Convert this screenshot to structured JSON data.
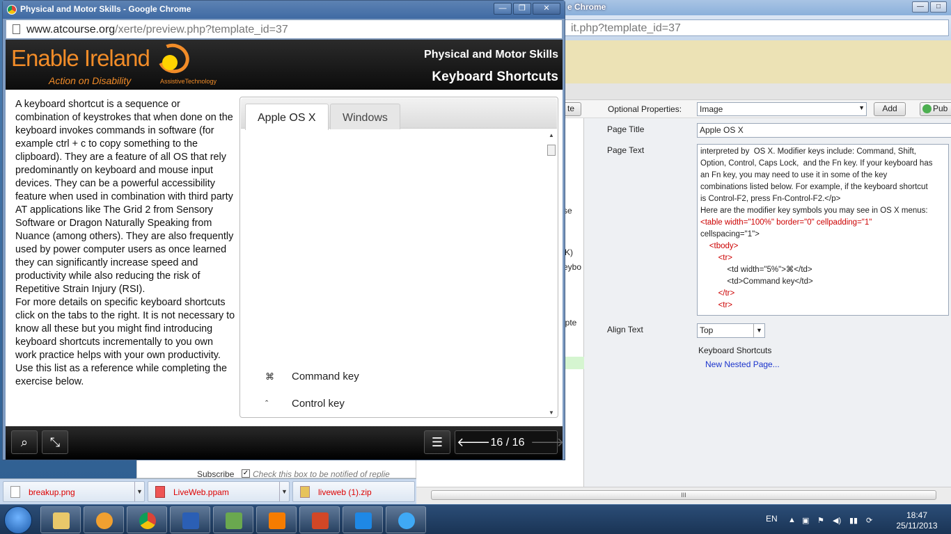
{
  "back_window": {
    "title_fragment": "e Chrome",
    "url_fragment": "it.php?template_id=37",
    "tab_fragment": "te",
    "optional_properties_label": "Optional Properties:",
    "optional_properties_value": "Image",
    "add_label": "Add",
    "pub_label": "Pub",
    "page_title_label": "Page Title",
    "page_title_value": "Apple OS X",
    "page_text_label": "Page Text",
    "align_text_label": "Align Text",
    "align_text_value": "Top",
    "keyboard_shortcuts_label": "Keyboard Shortcuts",
    "new_nested_page_label": "New Nested Page...",
    "side_fragments": [
      "se",
      "K)",
      "eybo",
      "apte"
    ],
    "code_lines": [
      "interpreted by  OS X. Modifier keys include: Command, Shift,",
      "Option, Control, Caps Lock,  and the Fn key. If your keyboard has",
      "an Fn key, you may need to use it in some of the key",
      "combinations listed below. For example, if the keyboard shortcut",
      "is Control-F2, press Fn-Control-F2.</p>",
      "Here are the modifier key symbols you may see in OS X menus:",
      "<table width=\"100%\" border=\"0\" cellpadding=\"1\"",
      "cellspacing=\"1\">",
      "    <tbody>",
      "        <tr>",
      "            <td width=\"5%\">⌘</td>",
      "            <td>Command key</td>",
      "        </tr>",
      "        <tr>"
    ]
  },
  "under_content": {
    "subscribe_label": "Subscribe",
    "checkbox_text": "Check this box to be notified of replie"
  },
  "downloads": [
    {
      "name": "breakup.png"
    },
    {
      "name": "LiveWeb.ppam"
    },
    {
      "name": "liveweb (1).zip"
    }
  ],
  "popup": {
    "title": "Physical and Motor Skills - Google Chrome",
    "url_domain": "www.atcourse.org",
    "url_path": "/xerte/preview.php?template_id=37",
    "logo_text": "Enable Ireland",
    "logo_tagline": "Action on Disability",
    "logo_sub": "AssistiveTechnology",
    "header_title": "Physical and Motor Skills",
    "header_subtitle": "Keyboard Shortcuts",
    "paragraph": "A keyboard shortcut is a sequence or combination of keystrokes that when done on the keyboard invokes commands in software (for example ctrl + c to copy something to the clipboard). They are a feature of all OS that rely predominantly on keyboard and mouse input devices. They can be a powerful accessibility feature when used in combination with third party AT applications like The Grid 2 from Sensory Software or Dragon Naturally Speaking from Nuance (among others). They are also frequently used by power computer users as once learned they can significantly increase speed and productivity while also reducing the risk of Repetitive Strain Injury (RSI).\nFor more details on specific keyboard shortcuts click on the tabs to the right. It is not necessary to know all these but you might find introducing keyboard shortcuts incrementally to you own work practice helps with your own productivity.\nUse this list as a reference while completing the exercise below.",
    "tabs": [
      {
        "label": "Apple OS X",
        "active": true
      },
      {
        "label": "Windows",
        "active": false
      }
    ],
    "keys": [
      {
        "symbol": "⌘",
        "label": "Command key"
      },
      {
        "symbol": "ˆ",
        "label": "Control key"
      }
    ],
    "page_indicator": "16 / 16"
  },
  "taskbar": {
    "language": "EN",
    "time": "18:47",
    "date": "25/11/2013"
  },
  "colors": {
    "brand_orange": "#f28c28",
    "logo_yellow": "#ffd300",
    "link_blue": "#1a33cc",
    "download_text_red": "#dd0000"
  }
}
